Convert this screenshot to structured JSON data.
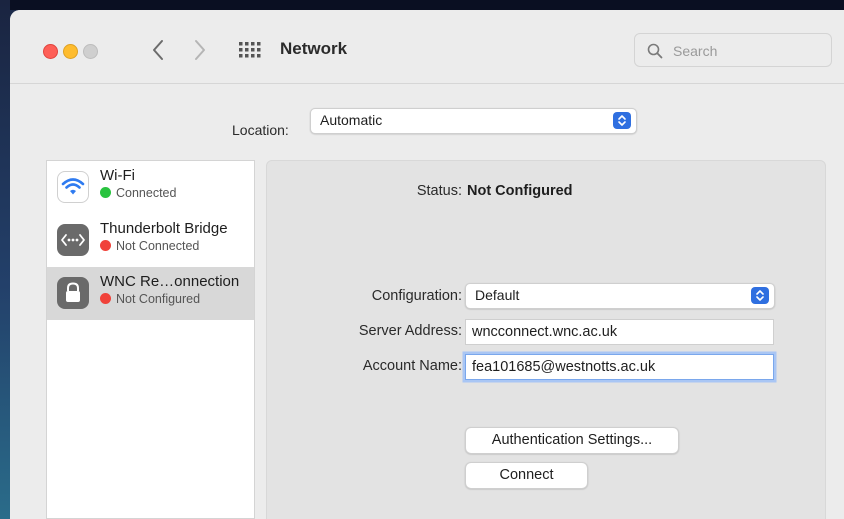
{
  "window": {
    "title": "Network",
    "search_placeholder": "Search"
  },
  "location": {
    "label": "Location:",
    "value": "Automatic"
  },
  "services": [
    {
      "name": "Wi-Fi",
      "status": "Connected",
      "status_color": "#29c33f",
      "icon": "wifi-icon"
    },
    {
      "name": "Thunderbolt Bridge",
      "status": "Not Connected",
      "status_color": "#f0423a",
      "icon": "thunderbolt-bridge-icon"
    },
    {
      "name": "WNC Re…onnection",
      "status": "Not Configured",
      "status_color": "#f0423a",
      "icon": "lock-icon"
    }
  ],
  "detail": {
    "status_label": "Status:",
    "status_value": "Not Configured",
    "configuration_label": "Configuration:",
    "configuration_value": "Default",
    "server_label": "Server Address:",
    "server_value": "wncconnect.wnc.ac.uk",
    "account_label": "Account Name:",
    "account_value": "fea101685@westnotts.ac.uk",
    "auth_button": "Authentication Settings...",
    "connect_button": "Connect"
  },
  "colors": {
    "accent": "#2f6fe0",
    "selected_row": "#d8d8d8"
  }
}
